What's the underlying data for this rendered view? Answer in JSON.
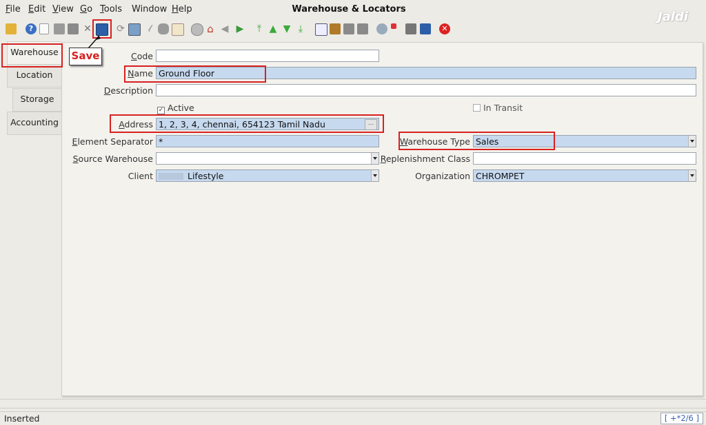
{
  "window": {
    "title": "Warehouse & Locators",
    "brand": "Jaldi"
  },
  "menu": [
    {
      "pre": "",
      "mn": "F",
      "post": "ile"
    },
    {
      "pre": "",
      "mn": "E",
      "post": "dit"
    },
    {
      "pre": "",
      "mn": "V",
      "post": "iew"
    },
    {
      "pre": "",
      "mn": "G",
      "post": "o"
    },
    {
      "pre": "",
      "mn": "T",
      "post": "ools"
    },
    {
      "pre": "Window",
      "mn": "",
      "post": ""
    },
    {
      "pre": "",
      "mn": "H",
      "post": "elp"
    }
  ],
  "toolbar": {
    "icons": [
      "undo-icon",
      "help-icon",
      "new-record-icon",
      "copy-record-icon",
      "delete-record-icon",
      "delete-selection-icon",
      "save-icon",
      "refresh-icon",
      "find-icon",
      "attachment-icon",
      "chat-icon",
      "grid-toggle-icon",
      "history-icon",
      "home-icon",
      "parent-record-icon",
      "detail-record-icon",
      "first-record-icon",
      "previous-record-icon",
      "next-record-icon",
      "last-record-icon",
      "report-icon",
      "archive-icon",
      "print-preview-icon",
      "print-icon",
      "zoom-across-icon",
      "workflow-icon",
      "product-info-icon",
      "end-window-icon",
      "close-icon"
    ],
    "save_callout": "Save"
  },
  "tabs": [
    {
      "label": "Warehouse",
      "active": true
    },
    {
      "label": "Location",
      "active": false
    },
    {
      "label": "Storage",
      "active": false
    },
    {
      "label": "Accounting",
      "active": false
    }
  ],
  "form": {
    "code": {
      "label_mn": "C",
      "label_rest": "ode",
      "value": ""
    },
    "name": {
      "label_mn": "N",
      "label_rest": "ame",
      "value": "Ground Floor"
    },
    "description": {
      "label_mn": "D",
      "label_rest": "escription",
      "value": ""
    },
    "active": {
      "label": "Active",
      "checked": true
    },
    "in_transit": {
      "label": "In Transit",
      "checked": false
    },
    "address": {
      "label_mn": "A",
      "label_rest": "ddress",
      "value": "1, 2, 3, 4, chennai,  654123 Tamil Nadu"
    },
    "element_separator": {
      "label_mn": "E",
      "label_rest": "lement Separator",
      "value": "*"
    },
    "warehouse_type": {
      "label_mn": "W",
      "label_rest": "arehouse Type",
      "value": "Sales"
    },
    "source_warehouse": {
      "label_mn": "S",
      "label_rest": "ource Warehouse",
      "value": ""
    },
    "replenishment_class": {
      "label_mn": "R",
      "label_rest": "eplenishment Class",
      "value": ""
    },
    "client": {
      "label": "Client",
      "value": "Lifestyle"
    },
    "organization": {
      "label": "Organization",
      "value": "CHROMPET"
    }
  },
  "status": {
    "message": "Inserted",
    "record": "[ +*2/6 ]"
  },
  "colors": {
    "highlight": "#d82020",
    "required_field": "#c6d9ef"
  }
}
